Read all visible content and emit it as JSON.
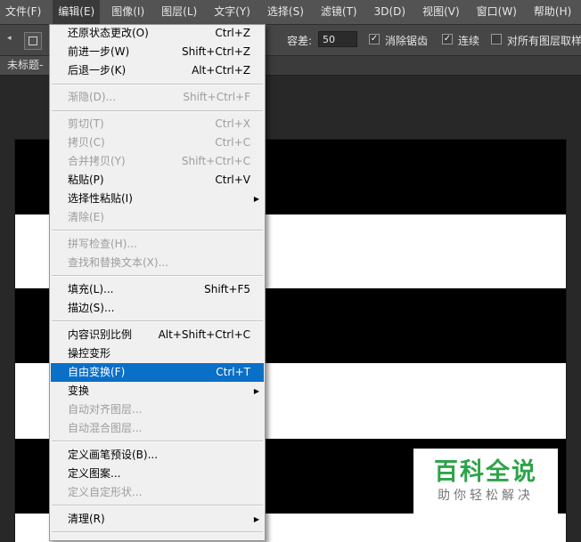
{
  "menubar": {
    "items": [
      "文件(F)",
      "编辑(E)",
      "图像(I)",
      "图层(L)",
      "文字(Y)",
      "选择(S)",
      "滤镜(T)",
      "3D(D)",
      "视图(V)",
      "窗口(W)",
      "帮助(H)"
    ],
    "active_index": 1
  },
  "options_bar": {
    "tolerance_label": "容差:",
    "tolerance_value": "50",
    "anti_alias_label": "消除锯齿",
    "anti_alias_checked": true,
    "contiguous_label": "连续",
    "contiguous_checked": true,
    "all_layers_label": "对所有图层取样",
    "all_layers_checked": false
  },
  "document_tab": {
    "title": "未标题-"
  },
  "edit_menu": {
    "items": [
      {
        "label": "还原状态更改(O)",
        "shortcut": "Ctrl+Z",
        "disabled": false
      },
      {
        "label": "前进一步(W)",
        "shortcut": "Shift+Ctrl+Z",
        "disabled": false
      },
      {
        "label": "后退一步(K)",
        "shortcut": "Alt+Ctrl+Z",
        "disabled": false
      },
      {
        "label": "渐隐(D)...",
        "shortcut": "Shift+Ctrl+F",
        "disabled": true
      },
      {
        "label": "剪切(T)",
        "shortcut": "Ctrl+X",
        "disabled": true
      },
      {
        "label": "拷贝(C)",
        "shortcut": "Ctrl+C",
        "disabled": true
      },
      {
        "label": "合并拷贝(Y)",
        "shortcut": "Shift+Ctrl+C",
        "disabled": true
      },
      {
        "label": "粘贴(P)",
        "shortcut": "Ctrl+V",
        "disabled": false
      },
      {
        "label": "选择性粘贴(I)",
        "shortcut": "",
        "disabled": false,
        "submenu": true
      },
      {
        "label": "清除(E)",
        "shortcut": "",
        "disabled": true
      },
      {
        "label": "拼写检查(H)...",
        "shortcut": "",
        "disabled": true
      },
      {
        "label": "查找和替换文本(X)...",
        "shortcut": "",
        "disabled": true
      },
      {
        "label": "填充(L)...",
        "shortcut": "Shift+F5",
        "disabled": false
      },
      {
        "label": "描边(S)...",
        "shortcut": "",
        "disabled": false
      },
      {
        "label": "内容识别比例",
        "shortcut": "Alt+Shift+Ctrl+C",
        "disabled": false
      },
      {
        "label": "操控变形",
        "shortcut": "",
        "disabled": false
      },
      {
        "label": "自由变换(F)",
        "shortcut": "Ctrl+T",
        "disabled": false,
        "highlighted": true
      },
      {
        "label": "变换",
        "shortcut": "",
        "disabled": false,
        "submenu": true
      },
      {
        "label": "自动对齐图层...",
        "shortcut": "",
        "disabled": true
      },
      {
        "label": "自动混合图层...",
        "shortcut": "",
        "disabled": true
      },
      {
        "label": "定义画笔预设(B)...",
        "shortcut": "",
        "disabled": false
      },
      {
        "label": "定义图案...",
        "shortcut": "",
        "disabled": false
      },
      {
        "label": "定义自定形状...",
        "shortcut": "",
        "disabled": true
      },
      {
        "label": "清理(R)",
        "shortcut": "",
        "disabled": false,
        "submenu": true
      }
    ]
  },
  "watermark": {
    "title": "百科全说",
    "subtitle": "助你轻松解决"
  },
  "colors": {
    "menu_highlight": "#0a6fc7",
    "watermark_green": "#2fa34a",
    "canvas_stripe": "#000000",
    "canvas_bg": "#ffffff"
  },
  "icons": {
    "submenu_arrow": "triangle-right-icon",
    "checkbox_check": "checkmark-icon",
    "tool_preset": "rectangle-selection-icon"
  }
}
